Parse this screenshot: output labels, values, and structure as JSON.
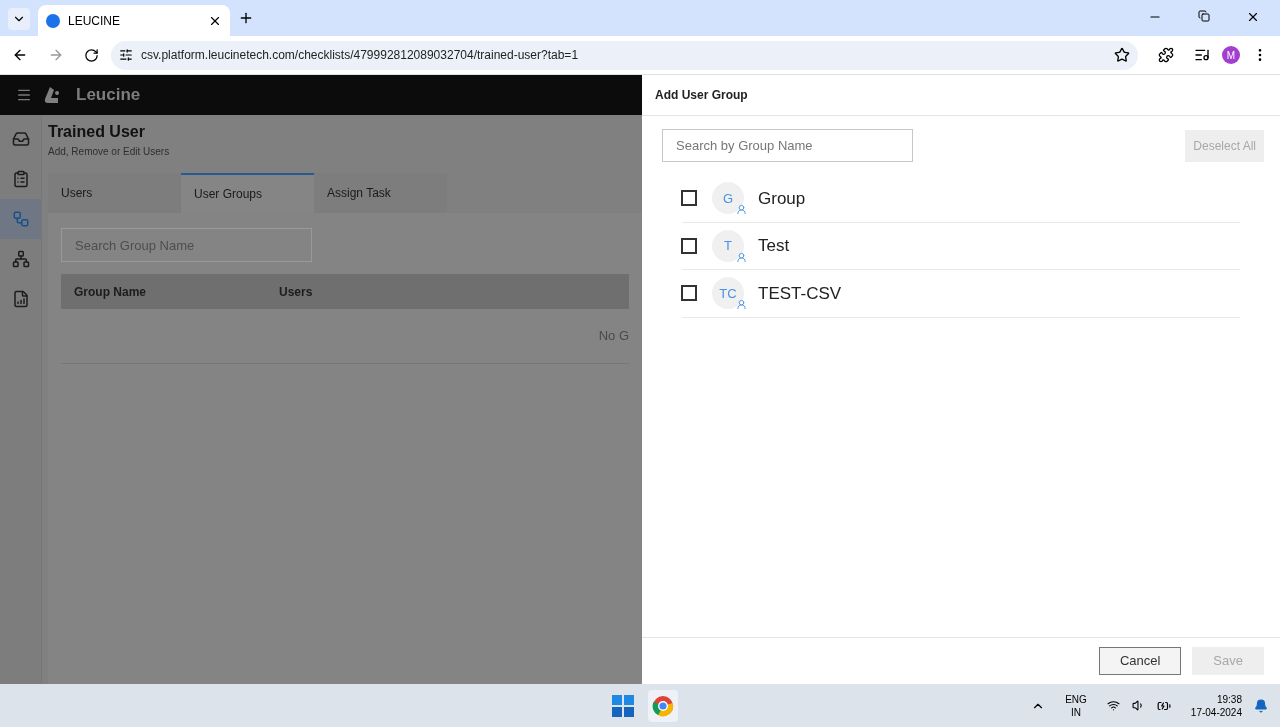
{
  "browser": {
    "tab_title": "LEUCINE",
    "url": "csv.platform.leucinetech.com/checklists/479992812089032704/trained-user?tab=1",
    "profile_initial": "M"
  },
  "app": {
    "brand": "Leucine",
    "sidebar": [
      {
        "kind": "inbox",
        "selected": false
      },
      {
        "kind": "checklist",
        "selected": false
      },
      {
        "kind": "flow",
        "selected": true
      },
      {
        "kind": "hierarchy",
        "selected": false
      },
      {
        "kind": "report",
        "selected": false
      }
    ],
    "title": "Trained User",
    "subtitle": "Add, Remove or Edit Users",
    "tabs": [
      {
        "label": "Users",
        "selected": false
      },
      {
        "label": "User Groups",
        "selected": true
      },
      {
        "label": "Assign Task",
        "selected": false
      }
    ],
    "search": {
      "placeholder": "Search Group Name"
    },
    "table": {
      "columns": [
        "Group Name",
        "Users"
      ],
      "empty_text": "No G"
    }
  },
  "drawer": {
    "title": "Add User Group",
    "search": {
      "placeholder": "Search by Group Name"
    },
    "deselect_all": {
      "label": "Deselect All",
      "disabled": true
    },
    "groups": [
      {
        "initials": "G",
        "name": "Group",
        "checked": false
      },
      {
        "initials": "T",
        "name": "Test",
        "checked": false
      },
      {
        "initials": "TC",
        "name": "TEST-CSV",
        "checked": false
      }
    ],
    "cancel": {
      "label": "Cancel",
      "disabled": false
    },
    "save": {
      "label": "Save",
      "disabled": true
    }
  },
  "taskbar": {
    "language": "ENG",
    "region": "IN",
    "time": "19:38",
    "date": "17-04-2024"
  }
}
